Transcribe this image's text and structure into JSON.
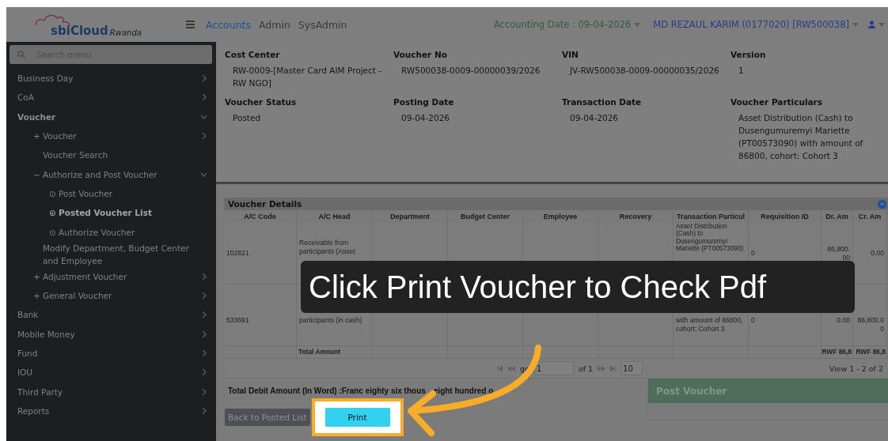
{
  "header": {
    "brand": "sbiCloud",
    "region": "Rwanda",
    "nav": [
      {
        "label": "Accounts",
        "selected": true
      },
      {
        "label": "Admin",
        "selected": false
      },
      {
        "label": "SysAdmin",
        "selected": false
      }
    ],
    "accounting_date": "Accounting Date : 09-04-2026",
    "user": "MD REZAUL KARIM (0177020) [RW500038]"
  },
  "sidebar": {
    "search": {
      "placeholder": "Search menu"
    },
    "items": [
      {
        "label": "Business Day",
        "kind": "folder",
        "expanded": false,
        "selected": false
      },
      {
        "label": "CoA",
        "kind": "folder",
        "expanded": false,
        "selected": false
      },
      {
        "label": "Voucher",
        "kind": "folder",
        "expanded": true,
        "selected": false,
        "children": [
          {
            "label": "Voucher",
            "marker": "+",
            "kind": "folder",
            "expanded": false,
            "selected": false
          },
          {
            "label": "Voucher Search",
            "kind": "link",
            "selected": false
          },
          {
            "label": "Authorize and Post Voucher",
            "marker": "−",
            "kind": "folder",
            "expanded": true,
            "selected": false,
            "children": [
              {
                "label": "Post Voucher",
                "marker": "⊙",
                "kind": "link",
                "selected": false
              },
              {
                "label": "Posted Voucher List",
                "marker": "⊙",
                "kind": "link",
                "selected": true
              },
              {
                "label": "Authorize Voucher",
                "marker": "⊙",
                "kind": "link",
                "selected": false
              }
            ]
          },
          {
            "label": "Modify Department, Budget Center and Employee",
            "kind": "link",
            "selected": false
          },
          {
            "label": "Adjustment Voucher",
            "marker": "+",
            "kind": "folder",
            "expanded": false,
            "selected": false
          },
          {
            "label": "General Voucher",
            "marker": "+",
            "kind": "folder",
            "expanded": false,
            "selected": false
          }
        ]
      },
      {
        "label": "Bank",
        "kind": "folder",
        "expanded": false,
        "selected": false
      },
      {
        "label": "Mobile Money",
        "kind": "folder",
        "expanded": false,
        "selected": false
      },
      {
        "label": "Fund",
        "kind": "folder",
        "expanded": false,
        "selected": false
      },
      {
        "label": "IOU",
        "kind": "folder",
        "expanded": false,
        "selected": false
      },
      {
        "label": "Third Party",
        "kind": "folder",
        "expanded": false,
        "selected": false
      },
      {
        "label": "Reports",
        "kind": "folder",
        "expanded": false,
        "selected": false
      }
    ]
  },
  "voucher_info": [
    {
      "label": "Cost Center",
      "value": "RW-0009-[Master Card AIM Project - RW NGO]"
    },
    {
      "label": "Voucher No",
      "value": "RW500038-0009-00000039/2026"
    },
    {
      "label": "VIN",
      "value": "JV-RW500038-0009-00000035/2026"
    },
    {
      "label": "Version",
      "value": "1"
    },
    {
      "label": "Voucher Status",
      "value": "Posted"
    },
    {
      "label": "Posting Date",
      "value": "09-04-2026"
    },
    {
      "label": "Transaction Date",
      "value": "09-04-2026"
    },
    {
      "label": "Voucher Particulars",
      "value": "Asset Distribution (Cash) to Dusengumuremyi Mariette (PT00573090) with amount of 86800, cohort: Cohort 3"
    }
  ],
  "details": {
    "title": "Voucher Details",
    "columns": [
      "A/C Code",
      "A/C Head",
      "Department",
      "Budget Center",
      "Employee",
      "Recovery",
      "Transaction Particul",
      "Requisition ID",
      "Dr. Am",
      "Cr. Am"
    ],
    "rows": [
      [
        "102821",
        "Receivable from participants (Asset",
        null,
        null,
        null,
        null,
        "Asset Distribution (Cash) to Dusengumuremyi Mariette (PT00573090)",
        "0",
        "86,800.00",
        "0.00"
      ],
      [
        "533691",
        "participants (in cash)",
        null,
        null,
        null,
        null,
        "with amount of 86800, cohort: Cohort 3",
        "0",
        "0.00",
        "86,800.00"
      ]
    ],
    "total": {
      "label": "Total Amount",
      "debit": "RWF 86,8",
      "credit": "RWF 86,8"
    },
    "pager": {
      "label": "ge",
      "page": "1",
      "of": "of 1",
      "size": "10",
      "view": "View 1 - 2 of 2"
    }
  },
  "amount_in_words": [
    "Total Debit Amount (In Word) :Franc eighty six thous",
    "eight hundred o"
  ],
  "buttons": {
    "back": "Back to Posted List",
    "print": "Print"
  },
  "callout": "Click Print Voucher to Check Pdf",
  "toast": {
    "title": "Post Voucher"
  }
}
